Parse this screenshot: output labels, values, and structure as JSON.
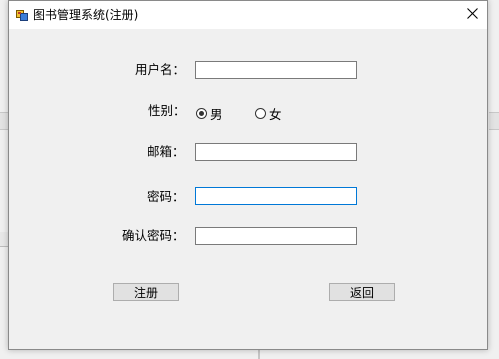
{
  "window": {
    "title": "图书管理系统(注册)"
  },
  "form": {
    "username_label": "用户名：",
    "gender_label": "性别：",
    "gender_options": [
      {
        "label": "男",
        "checked": true
      },
      {
        "label": "女",
        "checked": false
      }
    ],
    "email_label": "邮箱：",
    "password_label": "密码：",
    "confirm_password_label": "确认密码：",
    "username_value": "",
    "email_value": "",
    "password_value": "",
    "confirm_password_value": ""
  },
  "buttons": {
    "register_label": "注册",
    "back_label": "返回"
  },
  "colors": {
    "focus_border": "#0078d7",
    "button_bg": "#e1e1e1",
    "window_bg": "#f0f0f0"
  }
}
